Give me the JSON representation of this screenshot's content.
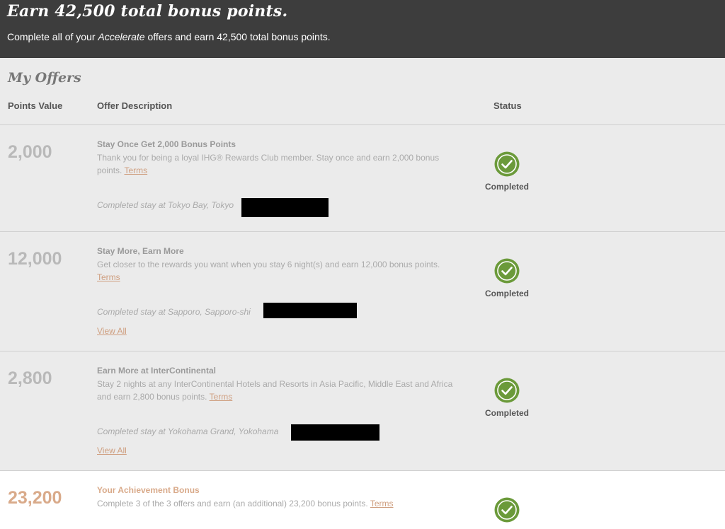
{
  "banner": {
    "title": "Earn 42,500 total bonus points.",
    "sub_before": "Complete all of your ",
    "sub_em": "Accelerate",
    "sub_after": " offers and earn 42,500 total bonus points."
  },
  "offers_title": "My Offers",
  "columns": {
    "points": "Points Value",
    "description": "Offer Description",
    "status": "Status"
  },
  "offers": [
    {
      "points": "2,000",
      "title": "Stay Once Get 2,000 Bonus Points",
      "description": "Thank you for being a loyal IHG® Rewards Club member. Stay once and earn 2,000 bonus points.",
      "terms": "Terms",
      "stay": "Completed stay at Tokyo Bay, Tokyo",
      "status": "Completed"
    },
    {
      "points": "12,000",
      "title": "Stay More, Earn More",
      "description": "Get closer to the rewards you want when you stay 6 night(s) and earn 12,000 bonus points.",
      "terms": "Terms",
      "stay": "Completed stay at Sapporo, Sapporo-shi",
      "view_all": "View All",
      "status": "Completed"
    },
    {
      "points": "2,800",
      "title": "Earn More at InterContinental",
      "description": "Stay 2 nights at any InterContinental Hotels and Resorts in Asia Pacific, Middle East and Africa and earn 2,800 bonus points.",
      "terms": "Terms",
      "stay": "Completed stay at Yokohama Grand, Yokohama",
      "view_all": "View All",
      "status": "Completed"
    }
  ],
  "bonus": {
    "points": "23,200",
    "title": "Your Achievement Bonus",
    "description": "Complete 3 of the 3 offers and earn (an additional) 23,200 bonus points.",
    "terms": "Terms"
  },
  "colors": {
    "check_green": "#6b9a3a",
    "link": "#cf9f80",
    "banner_bg": "#3d3d3d"
  },
  "icons": {
    "status": "check-circle-icon"
  }
}
